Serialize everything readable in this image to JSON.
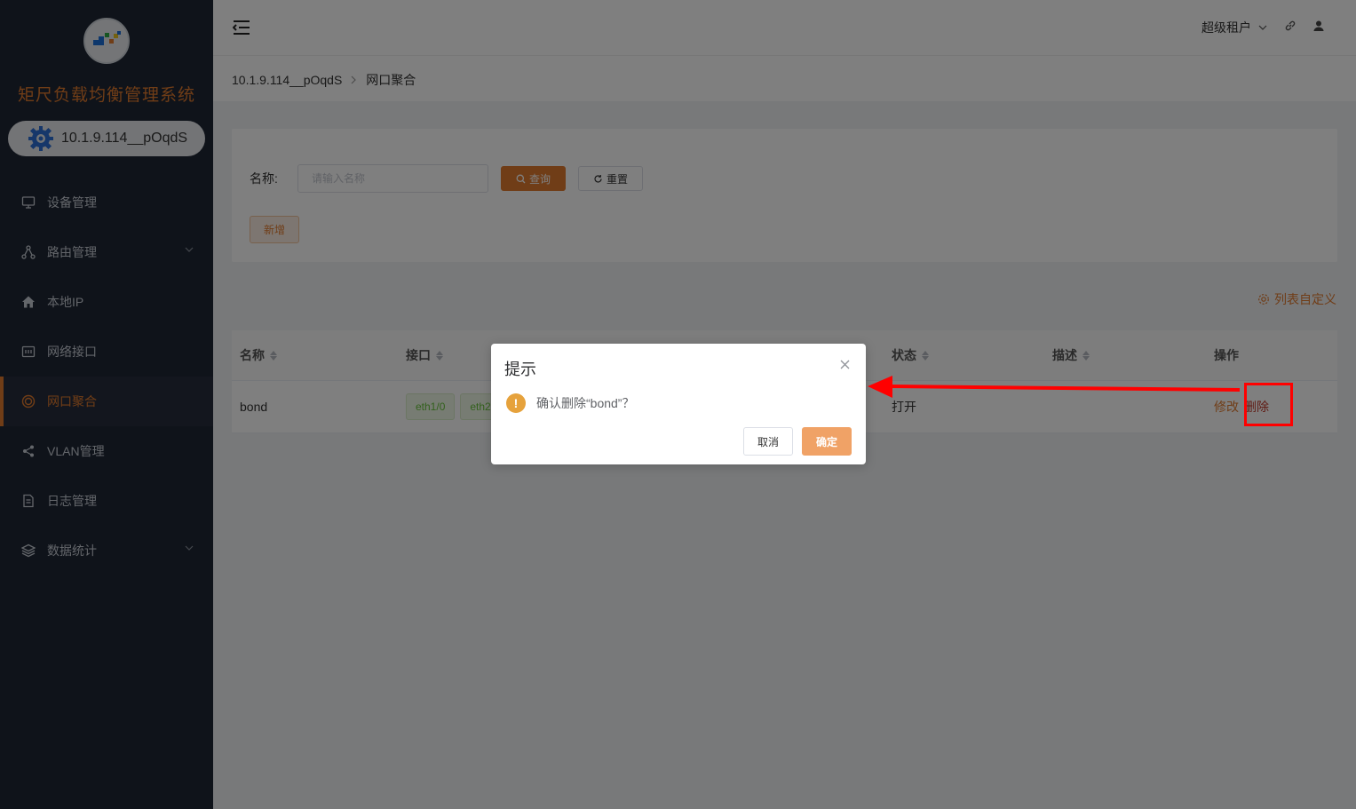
{
  "sidebar": {
    "app_title": "矩尺负载均衡管理系统",
    "device": "10.1.9.114__pOqdS",
    "items": [
      {
        "label": "设备管理",
        "icon": "monitor-icon"
      },
      {
        "label": "路由管理",
        "icon": "route-icon",
        "expandable": true
      },
      {
        "label": "本地IP",
        "icon": "home-icon"
      },
      {
        "label": "网络接口",
        "icon": "ethernet-icon"
      },
      {
        "label": "网口聚合",
        "icon": "aggregate-icon",
        "active": true
      },
      {
        "label": "VLAN管理",
        "icon": "share-icon"
      },
      {
        "label": "日志管理",
        "icon": "document-icon"
      },
      {
        "label": "数据统计",
        "icon": "layers-icon",
        "expandable": true
      }
    ]
  },
  "header": {
    "tenant": "超级租户"
  },
  "breadcrumb": {
    "root": "10.1.9.114__pOqdS",
    "current": "网口聚合"
  },
  "search": {
    "label": "名称:",
    "placeholder": "请输入名称",
    "query_label": "查询",
    "reset_label": "重置",
    "add_label": "新增"
  },
  "table": {
    "customize_label": "列表自定义",
    "columns": [
      "名称",
      "接口",
      "状态",
      "描述",
      "操作"
    ],
    "rows": [
      {
        "name": "bond",
        "interfaces": [
          "eth1/0",
          "eth2"
        ],
        "status": "打开",
        "description": "",
        "edit": "修改",
        "delete": "删除"
      }
    ]
  },
  "dialog": {
    "title": "提示",
    "message": "确认删除“bond”？",
    "cancel": "取消",
    "confirm": "确定"
  },
  "colors": {
    "accent": "#e07a2e",
    "sidebar_bg": "#1f2635",
    "warning": "#e6a23c",
    "annotation": "#ff0000"
  }
}
